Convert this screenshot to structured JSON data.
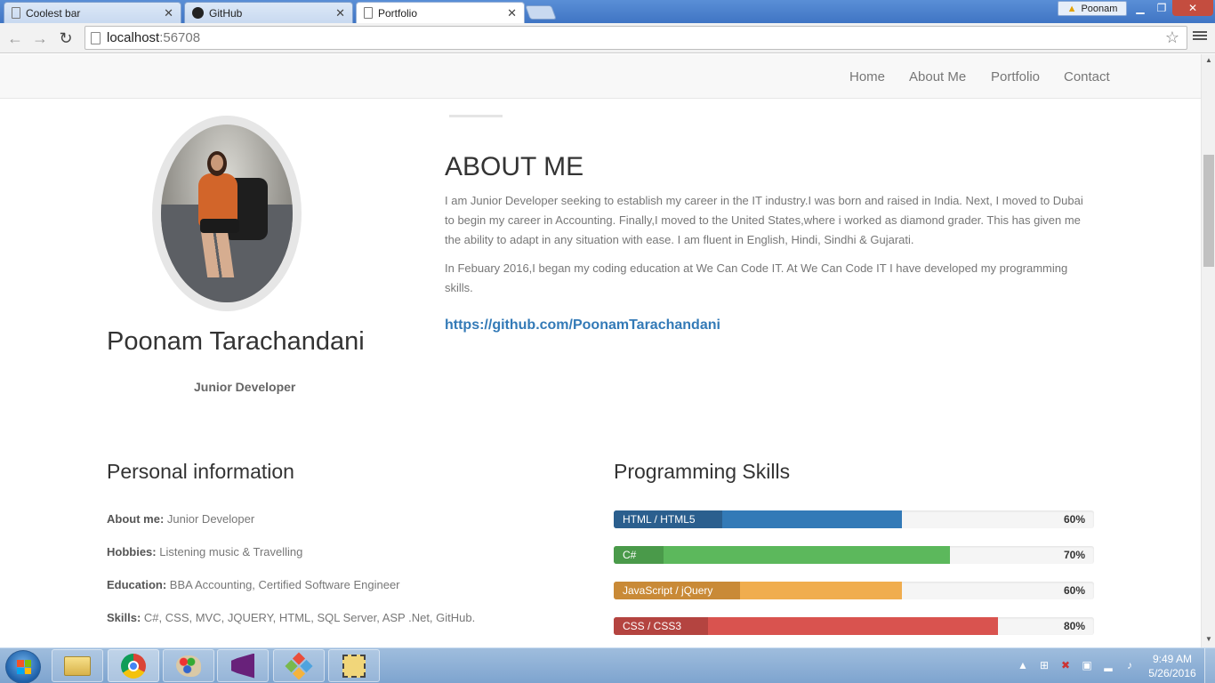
{
  "browser": {
    "tabs": [
      {
        "title": "Coolest bar",
        "active": false
      },
      {
        "title": "GitHub",
        "active": false
      },
      {
        "title": "Portfolio",
        "active": true
      }
    ],
    "profile_name": "Poonam",
    "url_host": "localhost",
    "url_port": ":56708"
  },
  "nav": {
    "items": [
      "Home",
      "About Me",
      "Portfolio",
      "Contact"
    ]
  },
  "profile": {
    "name": "Poonam Tarachandani",
    "role": "Junior Developer"
  },
  "about": {
    "title": "ABOUT ME",
    "paragraph1": "I am Junior Developer seeking to establish my career in the IT industry.I was born and raised in India. Next, I moved to Dubai to begin my career in Accounting. Finally,I moved to the United States,where i worked as diamond grader. This has given me the ability to adapt in any situation with ease. I am fluent in English, Hindi, Sindhi & Gujarati.",
    "paragraph2": "In Febuary 2016,I began my coding education at We Can Code IT. At We Can Code IT I have developed my programming skills.",
    "github_link": "https://github.com/PoonamTarachandani"
  },
  "personal": {
    "title": "Personal information",
    "rows": [
      {
        "label": "About me:",
        "value": "Junior Developer"
      },
      {
        "label": "Hobbies:",
        "value": "Listening music & Travelling"
      },
      {
        "label": "Education:",
        "value": "BBA Accounting, Certified Software Engineer"
      },
      {
        "label": "Skills:",
        "value": "C#, CSS, MVC, JQUERY, HTML, SQL Server, ASP .Net, GitHub."
      }
    ]
  },
  "skills": {
    "title": "Programming Skills",
    "items": [
      {
        "name": "HTML / HTML5",
        "percent_label": "60%",
        "level": 0.6,
        "color": "#337ab7",
        "tag_color": "#2b5f8e"
      },
      {
        "name": "C#",
        "percent_label": "70%",
        "level": 0.7,
        "color": "#5cb85c",
        "tag_color": "#4a9a4a"
      },
      {
        "name": "JavaScript / jQuery",
        "percent_label": "60%",
        "level": 0.6,
        "color": "#f0ad4e",
        "tag_color": "#c98a37"
      },
      {
        "name": "CSS / CSS3",
        "percent_label": "80%",
        "level": 0.8,
        "color": "#d9534f",
        "tag_color": "#b44440"
      }
    ]
  },
  "taskbar": {
    "time": "9:49 AM",
    "date": "5/26/2016",
    "pinned": [
      "file-explorer-icon",
      "chrome-icon",
      "paint-icon",
      "visual-studio-icon",
      "git-icon",
      "tools-icon"
    ]
  }
}
